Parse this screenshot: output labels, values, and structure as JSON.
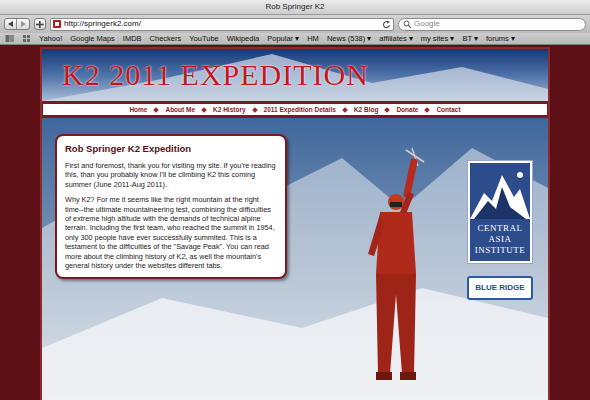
{
  "window": {
    "title": "Rob Springer K2"
  },
  "toolbar": {
    "address": "http://springerk2.com/",
    "search_placeholder": "Google"
  },
  "bookmarks": [
    {
      "label": "Yahoo!"
    },
    {
      "label": "Google Maps"
    },
    {
      "label": "IMDB"
    },
    {
      "label": "Checkers"
    },
    {
      "label": "YouTube"
    },
    {
      "label": "Wikipedia"
    },
    {
      "label": "Popular ▾"
    },
    {
      "label": "HM"
    },
    {
      "label": "News (538) ▾"
    },
    {
      "label": "affiliates ▾"
    },
    {
      "label": "my sites ▾"
    },
    {
      "label": "BT ▾"
    },
    {
      "label": "forums ▾"
    }
  ],
  "page": {
    "header_title": "K2 2011 EXPEDITION",
    "nav": [
      {
        "label": "Home"
      },
      {
        "label": "About Me"
      },
      {
        "label": "K2 History"
      },
      {
        "label": "2011 Expedition Details"
      },
      {
        "label": "K2 Blog"
      },
      {
        "label": "Donate"
      },
      {
        "label": "Contact"
      }
    ],
    "intro": {
      "heading": "Rob Springer K2 Expedition",
      "paragraphs": [
        "First and foremost, thank you for visiting my site. If you're reading this, than you probably know I'll be climbing K2 this coming summer (June 2011-Aug 2011).",
        "Why K2? For me it seems like the right mountain at the right time--the ultimate mountaineering test, combining the difficulties of extreme high altitude with the demands of technical alpine terrain. Including the first team, who reached the summit in 1954, only 300 people have ever successfully summited. This is a testament to the difficulties of the \"Savage Peak\". You can read more about the climbing history of K2, as well the mountain's general history under the websites different tabs."
      ]
    },
    "sponsors": [
      {
        "name": "CENTRAL ASIA INSTITUTE",
        "kind": "cai"
      },
      {
        "name": "BLUE RIDGE",
        "kind": "blue-ridge"
      }
    ]
  }
}
